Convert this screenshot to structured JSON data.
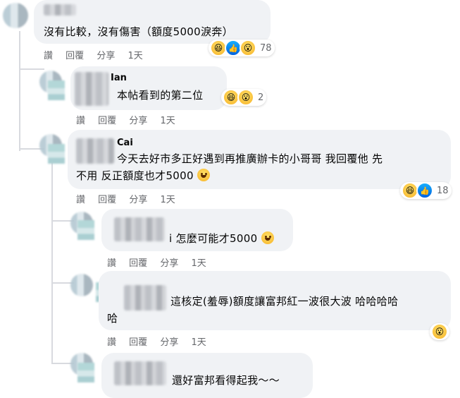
{
  "action_labels": {
    "like": "讚",
    "reply": "回覆",
    "share": "分享"
  },
  "comments": [
    {
      "text": "沒有比較，沒有傷害（額度5000淚奔）",
      "time": "1天",
      "reaction_icons": [
        "haha-icon",
        "like-icon",
        "wow-icon"
      ],
      "reaction_count": "78"
    },
    {
      "author": "Ian",
      "text": "本帖看到的第二位",
      "time": "1天",
      "reaction_icons": [
        "haha-icon",
        "wow-icon"
      ],
      "reaction_count": "2"
    },
    {
      "author": "Cai",
      "text_line1": "今天去好市多正好遇到再推廣辦卡的小哥哥 我回覆他 先",
      "text_line2": "不用 反正額度也才5000",
      "time": "1天",
      "reaction_icons": [
        "haha-icon",
        "like-icon"
      ],
      "reaction_count": "18"
    },
    {
      "text": "i 怎麼可能才5000",
      "time": "1天"
    },
    {
      "text_line1": "這核定(羞辱)額度讓富邦紅一波很大波 哈哈哈哈",
      "text_line2": "哈",
      "time": "1天",
      "reaction_icons": [
        "wow-icon"
      ]
    },
    {
      "text": "還好富邦看得起我～～"
    }
  ]
}
